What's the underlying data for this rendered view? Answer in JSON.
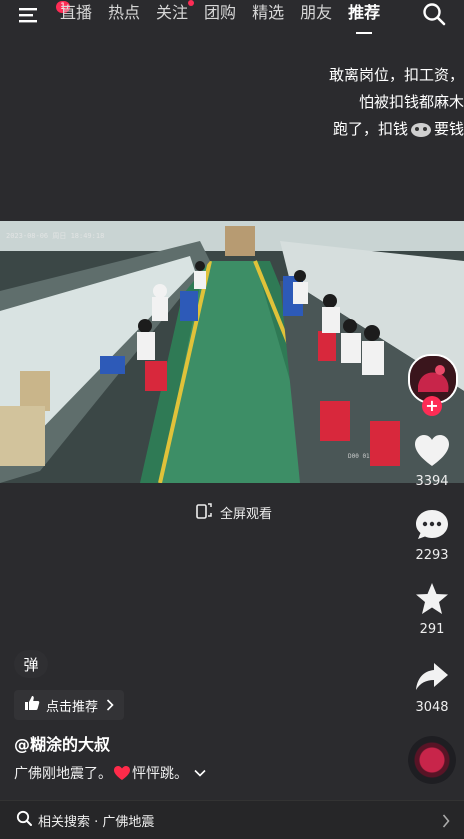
{
  "topbar": {
    "menu_badge": "1",
    "tabs": [
      {
        "label": "直播"
      },
      {
        "label": "热点"
      },
      {
        "label": "关注"
      },
      {
        "label": "团购"
      },
      {
        "label": "精选"
      },
      {
        "label": "朋友"
      },
      {
        "label": "推荐"
      }
    ],
    "active_tab": "推荐",
    "icons": {
      "menu": "menu-icon",
      "search": "search-icon"
    }
  },
  "caption": {
    "lines": [
      "敢离岗位，扣工资，",
      "怕被扣钱都麻木",
      "跑了，扣钱",
      "要钱"
    ]
  },
  "video": {
    "timestamp": "2023-08-06 周日 18:49:18",
    "camera_label": "D00 01"
  },
  "fullscreen": {
    "label": "全屏观看",
    "icon": "fullscreen-icon"
  },
  "actions": {
    "likes": "3394",
    "comments": "2293",
    "favorites": "291",
    "shares": "3048"
  },
  "danmu": {
    "label": "弹"
  },
  "recommend": {
    "label": "点击推荐"
  },
  "author": {
    "name": "@糊涂的大叔"
  },
  "description": {
    "text_before": "广佛刚地震了。",
    "text_after": "怦怦跳。"
  },
  "related": {
    "label": "相关搜索 · 广佛地震"
  },
  "colors": {
    "accent": "#fe2c55",
    "background": "#2b2b2e"
  }
}
